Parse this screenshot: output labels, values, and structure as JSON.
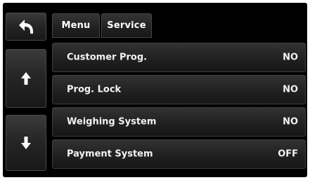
{
  "tabs": {
    "menu_label": "Menu",
    "service_label": "Service"
  },
  "icons": {
    "back": "back-arrow-icon",
    "up": "arrow-up-icon",
    "down": "arrow-down-icon"
  },
  "settings": [
    {
      "label": "Customer Prog.",
      "value": "NO"
    },
    {
      "label": "Prog. Lock",
      "value": "NO"
    },
    {
      "label": "Weighing System",
      "value": "NO"
    },
    {
      "label": "Payment System",
      "value": "OFF"
    }
  ]
}
